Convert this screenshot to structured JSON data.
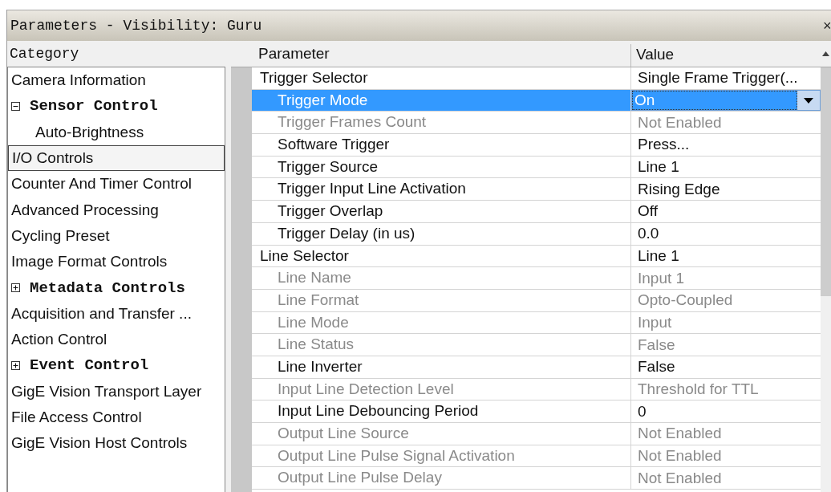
{
  "window": {
    "title": "Parameters - Visibility: Guru",
    "close": "×"
  },
  "category": {
    "header": "Category",
    "items": [
      {
        "label": "Camera Information",
        "selected": false
      },
      {
        "label": "Sensor Control",
        "selected": false,
        "expanded": true,
        "children": [
          {
            "label": "Auto-Brightness",
            "selected": false
          }
        ]
      },
      {
        "label": "I/O Controls",
        "selected": true
      },
      {
        "label": "Counter And Timer Control",
        "selected": false
      },
      {
        "label": "Advanced Processing",
        "selected": false
      },
      {
        "label": "Cycling Preset",
        "selected": false
      },
      {
        "label": "Image Format Controls",
        "selected": false
      },
      {
        "label": "Metadata Controls",
        "selected": false,
        "expanded": false
      },
      {
        "label": "Acquisition and Transfer ...",
        "selected": false
      },
      {
        "label": "Action Control",
        "selected": false
      },
      {
        "label": "Event Control",
        "selected": false,
        "expanded": false
      },
      {
        "label": "GigE Vision Transport Layer",
        "selected": false
      },
      {
        "label": "File Access Control",
        "selected": false
      },
      {
        "label": "GigE Vision Host Controls",
        "selected": false
      }
    ]
  },
  "table": {
    "columns": [
      "Parameter",
      "Value"
    ],
    "rows": [
      {
        "name": "Trigger Selector",
        "value": "Single Frame Trigger(...",
        "enabled": true,
        "selected": false,
        "children": [
          {
            "name": "Trigger Mode",
            "value": "On",
            "enabled": true,
            "selected": true,
            "kind": "dropdown"
          },
          {
            "name": "Trigger Frames Count",
            "value": "Not Enabled",
            "enabled": false,
            "selected": false
          },
          {
            "name": "Software Trigger",
            "value": "Press...",
            "enabled": true,
            "selected": false
          },
          {
            "name": "Trigger Source",
            "value": "Line 1",
            "enabled": true,
            "selected": false
          },
          {
            "name": "Trigger Input Line Activation",
            "value": "Rising Edge",
            "enabled": true,
            "selected": false
          },
          {
            "name": "Trigger Overlap",
            "value": "Off",
            "enabled": true,
            "selected": false
          },
          {
            "name": "Trigger Delay (in us)",
            "value": "0.0",
            "enabled": true,
            "selected": false
          }
        ]
      },
      {
        "name": "Line Selector",
        "value": "Line 1",
        "enabled": true,
        "selected": false,
        "children": [
          {
            "name": "Line Name",
            "value": "Input 1",
            "enabled": false,
            "selected": false
          },
          {
            "name": "Line Format",
            "value": "Opto-Coupled",
            "enabled": false,
            "selected": false
          },
          {
            "name": "Line Mode",
            "value": "Input",
            "enabled": false,
            "selected": false
          },
          {
            "name": "Line Status",
            "value": "False",
            "enabled": false,
            "selected": false
          },
          {
            "name": "Line Inverter",
            "value": "False",
            "enabled": true,
            "selected": false
          },
          {
            "name": "Input Line Detection Level",
            "value": "Threshold for TTL",
            "enabled": false,
            "selected": false
          },
          {
            "name": "Input Line Debouncing Period",
            "value": "0",
            "enabled": true,
            "selected": false
          },
          {
            "name": "Output Line Source",
            "value": "Not Enabled",
            "enabled": false,
            "selected": false
          },
          {
            "name": "Output Line Pulse Signal Activation",
            "value": "Not Enabled",
            "enabled": false,
            "selected": false
          },
          {
            "name": "Output Line Pulse Delay",
            "value": "Not Enabled",
            "enabled": false,
            "selected": false
          }
        ]
      }
    ]
  }
}
